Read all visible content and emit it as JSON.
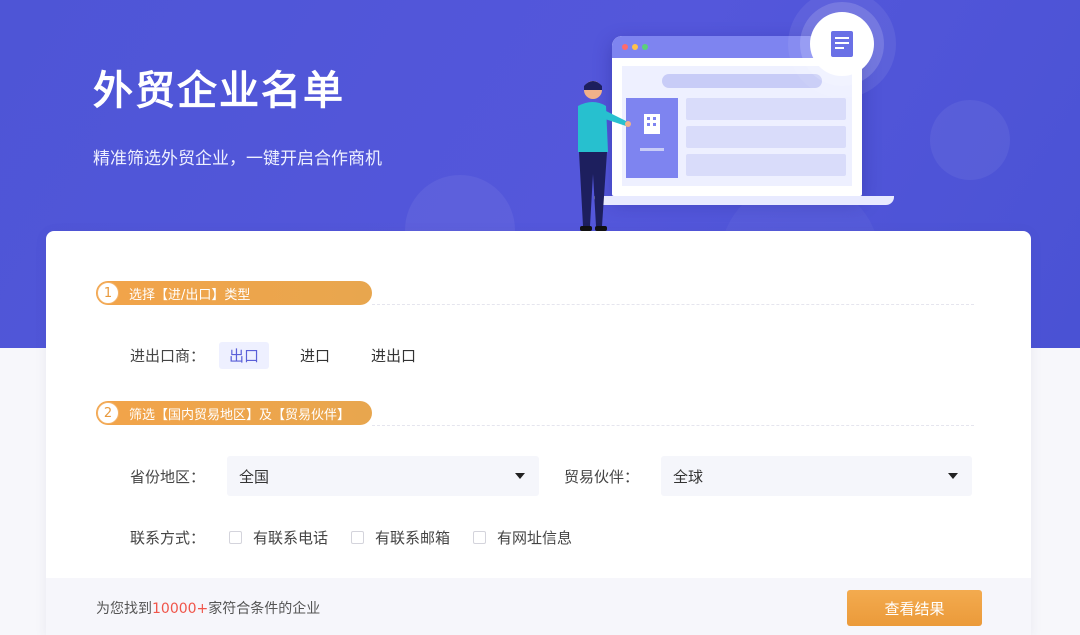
{
  "hero": {
    "title": "外贸企业名单",
    "subtitle": "精准筛选外贸企业，一键开启合作商机"
  },
  "steps": [
    {
      "number": "1",
      "label": "选择【进/出口】类型"
    },
    {
      "number": "2",
      "label": "筛选【国内贸易地区】及【贸易伙伴】"
    }
  ],
  "trade_type": {
    "label": "进出口商：",
    "options": [
      "出口",
      "进口",
      "进出口"
    ],
    "selected": "出口"
  },
  "region": {
    "label": "省份地区：",
    "value": "全国"
  },
  "partner": {
    "label": "贸易伙伴：",
    "value": "全球"
  },
  "contact": {
    "label": "联系方式：",
    "options": [
      "有联系电话",
      "有联系邮箱",
      "有网址信息"
    ]
  },
  "footer": {
    "prefix": "为您找到",
    "count": "10000+",
    "suffix": "家符合条件的企业",
    "button": "查看结果"
  },
  "colors": {
    "hero_bg": "#5056d8",
    "accent_orange": "#eb9a3a",
    "count_red": "#f0554a",
    "active_option_text": "#5a5fd8"
  }
}
